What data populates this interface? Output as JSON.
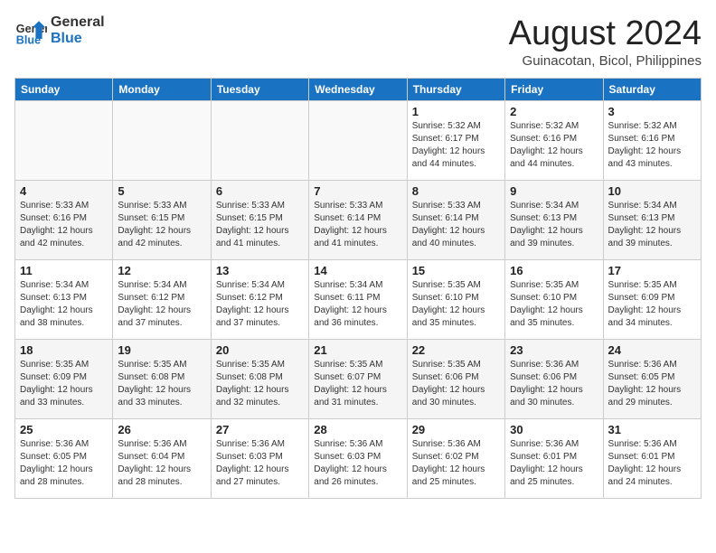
{
  "header": {
    "logo_line1": "General",
    "logo_line2": "Blue",
    "month_title": "August 2024",
    "location": "Guinacotan, Bicol, Philippines"
  },
  "weekdays": [
    "Sunday",
    "Monday",
    "Tuesday",
    "Wednesday",
    "Thursday",
    "Friday",
    "Saturday"
  ],
  "weeks": [
    [
      {
        "day": "",
        "info": ""
      },
      {
        "day": "",
        "info": ""
      },
      {
        "day": "",
        "info": ""
      },
      {
        "day": "",
        "info": ""
      },
      {
        "day": "1",
        "info": "Sunrise: 5:32 AM\nSunset: 6:17 PM\nDaylight: 12 hours\nand 44 minutes."
      },
      {
        "day": "2",
        "info": "Sunrise: 5:32 AM\nSunset: 6:16 PM\nDaylight: 12 hours\nand 44 minutes."
      },
      {
        "day": "3",
        "info": "Sunrise: 5:32 AM\nSunset: 6:16 PM\nDaylight: 12 hours\nand 43 minutes."
      }
    ],
    [
      {
        "day": "4",
        "info": "Sunrise: 5:33 AM\nSunset: 6:16 PM\nDaylight: 12 hours\nand 42 minutes."
      },
      {
        "day": "5",
        "info": "Sunrise: 5:33 AM\nSunset: 6:15 PM\nDaylight: 12 hours\nand 42 minutes."
      },
      {
        "day": "6",
        "info": "Sunrise: 5:33 AM\nSunset: 6:15 PM\nDaylight: 12 hours\nand 41 minutes."
      },
      {
        "day": "7",
        "info": "Sunrise: 5:33 AM\nSunset: 6:14 PM\nDaylight: 12 hours\nand 41 minutes."
      },
      {
        "day": "8",
        "info": "Sunrise: 5:33 AM\nSunset: 6:14 PM\nDaylight: 12 hours\nand 40 minutes."
      },
      {
        "day": "9",
        "info": "Sunrise: 5:34 AM\nSunset: 6:13 PM\nDaylight: 12 hours\nand 39 minutes."
      },
      {
        "day": "10",
        "info": "Sunrise: 5:34 AM\nSunset: 6:13 PM\nDaylight: 12 hours\nand 39 minutes."
      }
    ],
    [
      {
        "day": "11",
        "info": "Sunrise: 5:34 AM\nSunset: 6:13 PM\nDaylight: 12 hours\nand 38 minutes."
      },
      {
        "day": "12",
        "info": "Sunrise: 5:34 AM\nSunset: 6:12 PM\nDaylight: 12 hours\nand 37 minutes."
      },
      {
        "day": "13",
        "info": "Sunrise: 5:34 AM\nSunset: 6:12 PM\nDaylight: 12 hours\nand 37 minutes."
      },
      {
        "day": "14",
        "info": "Sunrise: 5:34 AM\nSunset: 6:11 PM\nDaylight: 12 hours\nand 36 minutes."
      },
      {
        "day": "15",
        "info": "Sunrise: 5:35 AM\nSunset: 6:10 PM\nDaylight: 12 hours\nand 35 minutes."
      },
      {
        "day": "16",
        "info": "Sunrise: 5:35 AM\nSunset: 6:10 PM\nDaylight: 12 hours\nand 35 minutes."
      },
      {
        "day": "17",
        "info": "Sunrise: 5:35 AM\nSunset: 6:09 PM\nDaylight: 12 hours\nand 34 minutes."
      }
    ],
    [
      {
        "day": "18",
        "info": "Sunrise: 5:35 AM\nSunset: 6:09 PM\nDaylight: 12 hours\nand 33 minutes."
      },
      {
        "day": "19",
        "info": "Sunrise: 5:35 AM\nSunset: 6:08 PM\nDaylight: 12 hours\nand 33 minutes."
      },
      {
        "day": "20",
        "info": "Sunrise: 5:35 AM\nSunset: 6:08 PM\nDaylight: 12 hours\nand 32 minutes."
      },
      {
        "day": "21",
        "info": "Sunrise: 5:35 AM\nSunset: 6:07 PM\nDaylight: 12 hours\nand 31 minutes."
      },
      {
        "day": "22",
        "info": "Sunrise: 5:35 AM\nSunset: 6:06 PM\nDaylight: 12 hours\nand 30 minutes."
      },
      {
        "day": "23",
        "info": "Sunrise: 5:36 AM\nSunset: 6:06 PM\nDaylight: 12 hours\nand 30 minutes."
      },
      {
        "day": "24",
        "info": "Sunrise: 5:36 AM\nSunset: 6:05 PM\nDaylight: 12 hours\nand 29 minutes."
      }
    ],
    [
      {
        "day": "25",
        "info": "Sunrise: 5:36 AM\nSunset: 6:05 PM\nDaylight: 12 hours\nand 28 minutes."
      },
      {
        "day": "26",
        "info": "Sunrise: 5:36 AM\nSunset: 6:04 PM\nDaylight: 12 hours\nand 28 minutes."
      },
      {
        "day": "27",
        "info": "Sunrise: 5:36 AM\nSunset: 6:03 PM\nDaylight: 12 hours\nand 27 minutes."
      },
      {
        "day": "28",
        "info": "Sunrise: 5:36 AM\nSunset: 6:03 PM\nDaylight: 12 hours\nand 26 minutes."
      },
      {
        "day": "29",
        "info": "Sunrise: 5:36 AM\nSunset: 6:02 PM\nDaylight: 12 hours\nand 25 minutes."
      },
      {
        "day": "30",
        "info": "Sunrise: 5:36 AM\nSunset: 6:01 PM\nDaylight: 12 hours\nand 25 minutes."
      },
      {
        "day": "31",
        "info": "Sunrise: 5:36 AM\nSunset: 6:01 PM\nDaylight: 12 hours\nand 24 minutes."
      }
    ]
  ]
}
